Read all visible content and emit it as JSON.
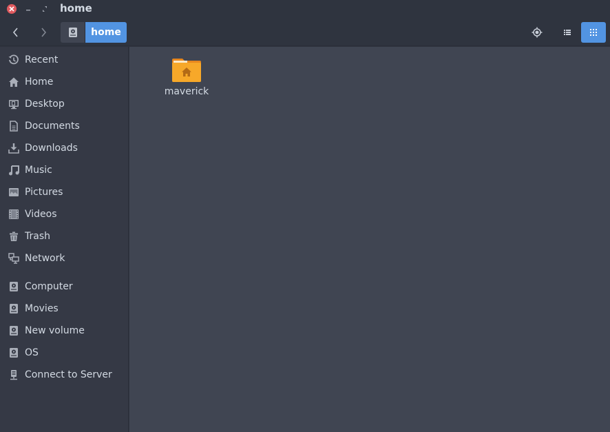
{
  "window": {
    "title": "home",
    "controls": {
      "close": "close-icon",
      "minimize": "minimize-icon",
      "maximize": "maximize-icon"
    }
  },
  "toolbar": {
    "back_icon": "chevron-left-icon",
    "forward_icon": "chevron-right-icon",
    "path": [
      {
        "icon": "drive-icon",
        "label": ""
      },
      {
        "label": "home"
      }
    ],
    "locate_icon": "crosshair-icon",
    "list_view_icon": "list-icon",
    "grid_view_icon": "grid-icon",
    "active_view": "grid"
  },
  "sidebar": {
    "items": [
      {
        "label": "Recent",
        "icon": "recent-icon"
      },
      {
        "label": "Home",
        "icon": "home-icon"
      },
      {
        "label": "Desktop",
        "icon": "desktop-icon"
      },
      {
        "label": "Documents",
        "icon": "document-icon"
      },
      {
        "label": "Downloads",
        "icon": "download-icon"
      },
      {
        "label": "Music",
        "icon": "music-icon"
      },
      {
        "label": "Pictures",
        "icon": "picture-icon"
      },
      {
        "label": "Videos",
        "icon": "video-icon"
      },
      {
        "label": "Trash",
        "icon": "trash-icon"
      },
      {
        "label": "Network",
        "icon": "network-icon"
      }
    ],
    "devices": [
      {
        "label": "Computer",
        "icon": "drive-icon"
      },
      {
        "label": "Movies",
        "icon": "drive-icon"
      },
      {
        "label": "New volume",
        "icon": "drive-icon"
      },
      {
        "label": "OS",
        "icon": "drive-icon"
      },
      {
        "label": "Connect to Server",
        "icon": "server-icon"
      }
    ]
  },
  "main": {
    "files": [
      {
        "name": "maverick",
        "icon": "home-folder-icon"
      }
    ]
  },
  "colors": {
    "accent": "#5294e2",
    "folder": "#f7a829",
    "close": "#e05a5f"
  }
}
